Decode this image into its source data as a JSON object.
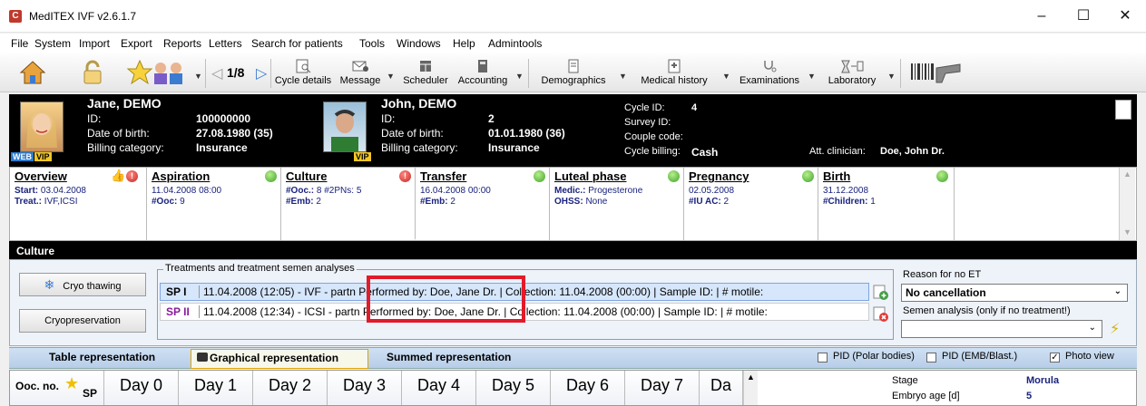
{
  "window": {
    "title": "MedITEX IVF v2.6.1.7",
    "icon": "C"
  },
  "menu": [
    "File",
    "System",
    "Import",
    "Export",
    "Reports",
    "Letters",
    "Search for patients",
    "Tools",
    "Windows",
    "Help",
    "Admintools"
  ],
  "toolbar": {
    "pager": "1/8",
    "buttons": [
      "Cycle details",
      "Message",
      "Scheduler",
      "Accounting",
      "Demographics",
      "Medical history",
      "Examinations",
      "Laboratory"
    ]
  },
  "patient_female": {
    "name": "Jane, DEMO",
    "id_label": "ID:",
    "id": "100000000",
    "dob_label": "Date of birth:",
    "dob": "27.08.1980  (35)",
    "billing_label": "Billing category:",
    "billing": "Insurance",
    "badge_web": "WEB",
    "badge_vip": "VIP"
  },
  "patient_male": {
    "name": "John, DEMO",
    "id_label": "ID:",
    "id": "2",
    "dob_label": "Date of birth:",
    "dob": "01.01.1980  (36)",
    "billing_label": "Billing category:",
    "billing": "Insurance",
    "badge_vip": "VIP"
  },
  "cycle": {
    "cycle_id_label": "Cycle ID:",
    "cycle_id": "4",
    "survey_id_label": "Survey ID:",
    "couple_code_label": "Couple code:",
    "cycle_billing_label": "Cycle billing:",
    "cycle_billing": "Cash",
    "clinician_label": "Att. clinician:",
    "clinician": "Doe, John Dr."
  },
  "phases": [
    {
      "title": "Overview",
      "l1a": "Start: ",
      "l1b": "03.04.2008",
      "l2a": "Treat.: ",
      "l2b": "IVF,ICSI"
    },
    {
      "title": "Aspiration",
      "l1a": "",
      "l1b": "11.04.2008 08:00",
      "l2a": "#Ooc: ",
      "l2b": "9"
    },
    {
      "title": "Culture",
      "l1a": "#Ooc.: ",
      "l1b": "8  #2PNs: 5",
      "l2a": "#Emb: ",
      "l2b": "2"
    },
    {
      "title": "Transfer",
      "l1a": "",
      "l1b": "16.04.2008 00:00",
      "l2a": "#Emb: ",
      "l2b": "2"
    },
    {
      "title": "Luteal phase",
      "l1a": "Medic.: ",
      "l1b": "Progesterone",
      "l2a": "OHSS: ",
      "l2b": "None"
    },
    {
      "title": "Pregnancy",
      "l1a": "",
      "l1b": "02.05.2008",
      "l2a": "#IU AC: ",
      "l2b": "2"
    },
    {
      "title": "Birth",
      "l1a": "",
      "l1b": "31.12.2008",
      "l2a": "#Children: ",
      "l2b": "1"
    }
  ],
  "culture": {
    "header": "Culture",
    "cryo_thawing": "Cryo thawing",
    "cryopreservation": "Cryopreservation",
    "group_label": "Treatments and treatment semen analyses",
    "rows": [
      {
        "id": "SP I",
        "text": "11.04.2008 (12:05) - IVF - partn Performed by: Doe, Jane Dr.  | Collection: 11.04.2008 (00:00)  | Sample ID:  | # motile:"
      },
      {
        "id": "SP II",
        "text": "11.04.2008 (12:34) - ICSI - partn Performed by: Doe, Jane Dr.  | Collection: 11.04.2008 (00:00)  | Sample ID:  | # motile:"
      }
    ],
    "reason_label": "Reason for no ET",
    "reason_value": "No cancellation",
    "semen_label": "Semen analysis (only if no treatment!)",
    "semen_value": ""
  },
  "tabs": {
    "table": "Table representation",
    "graphical": "Graphical representation",
    "summed": "Summed representation",
    "pid_polar": "PID (Polar bodies)",
    "pid_emb": "PID (EMB/Blast.)",
    "photo_view": "Photo view"
  },
  "grid": {
    "ooc_label": "Ooc. no.",
    "sp_label": "SP",
    "days": [
      "Day 0",
      "Day 1",
      "Day 2",
      "Day 3",
      "Day 4",
      "Day 5",
      "Day 6",
      "Day 7",
      "Da"
    ],
    "stage_label": "Stage",
    "stage_value": "Morula",
    "age_label": "Embryo age [d]",
    "age_value": "5"
  },
  "colors": {
    "highlight_box": "#e21b2a",
    "accent_blue": "#1a237e"
  }
}
